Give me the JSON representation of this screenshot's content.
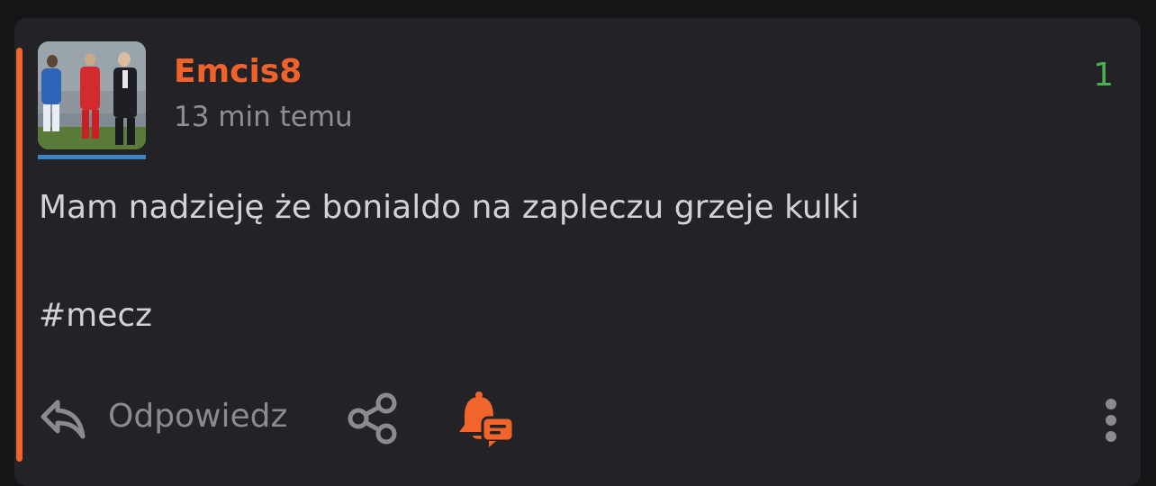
{
  "colors": {
    "background": "#151517",
    "card": "#232327",
    "accent": "#f1642b",
    "username": "#f0622a",
    "timestamp": "#8e8e93",
    "votes": "#4caf50",
    "content": "#d2d2d6",
    "actions": "#8a8a8f",
    "avatar_underline": "#3b84c4"
  },
  "post": {
    "username": "Emcis8",
    "timestamp": "13 min temu",
    "votes": "1",
    "body": "Mam nadzieję że bonialdo na zapleczu grzeje kulki",
    "tag": "#mecz"
  },
  "actions": {
    "reply_label": "Odpowiedz",
    "reply_icon": "reply-arrow-icon",
    "share_icon": "share-icon",
    "notify_icon": "bell-comment-icon",
    "more_icon": "more-vertical-icon"
  }
}
